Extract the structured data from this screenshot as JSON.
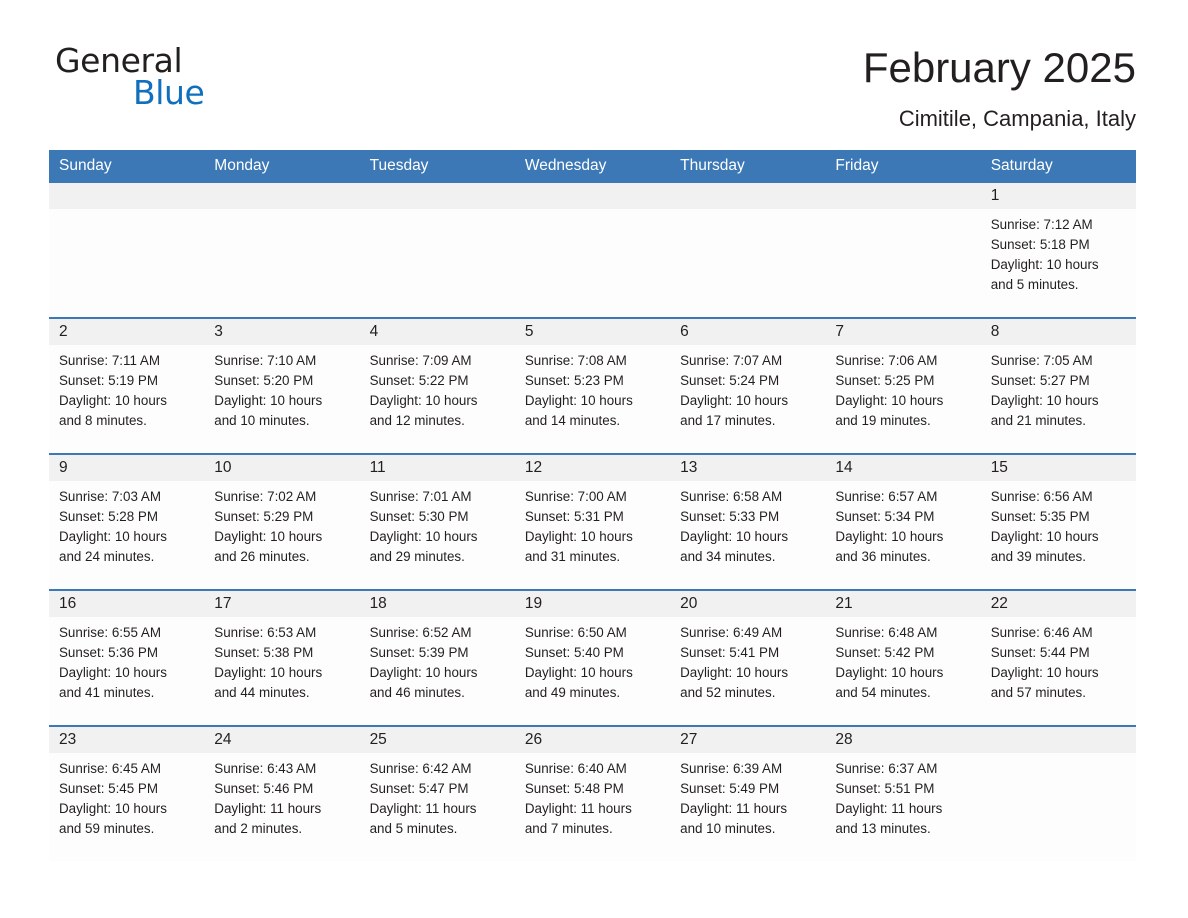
{
  "brand": {
    "name_part1": "General",
    "name_part2": "Blue",
    "logo_icon": "triangle-logo-icon",
    "accent_color": "#1070bd"
  },
  "header": {
    "title": "February 2025",
    "location": "Cimitile, Campania, Italy"
  },
  "theme": {
    "header_blue": "#3b78b5",
    "day_band_gray": "#f1f1f1",
    "text_color": "#231f20"
  },
  "weekdays": [
    "Sunday",
    "Monday",
    "Tuesday",
    "Wednesday",
    "Thursday",
    "Friday",
    "Saturday"
  ],
  "weeks": [
    [
      {
        "day": "",
        "sunrise": "",
        "sunset": "",
        "daylight_line1": "",
        "daylight_line2": "",
        "empty": true
      },
      {
        "day": "",
        "sunrise": "",
        "sunset": "",
        "daylight_line1": "",
        "daylight_line2": "",
        "empty": true
      },
      {
        "day": "",
        "sunrise": "",
        "sunset": "",
        "daylight_line1": "",
        "daylight_line2": "",
        "empty": true
      },
      {
        "day": "",
        "sunrise": "",
        "sunset": "",
        "daylight_line1": "",
        "daylight_line2": "",
        "empty": true
      },
      {
        "day": "",
        "sunrise": "",
        "sunset": "",
        "daylight_line1": "",
        "daylight_line2": "",
        "empty": true
      },
      {
        "day": "",
        "sunrise": "",
        "sunset": "",
        "daylight_line1": "",
        "daylight_line2": "",
        "empty": true
      },
      {
        "day": "1",
        "sunrise": "Sunrise: 7:12 AM",
        "sunset": "Sunset: 5:18 PM",
        "daylight_line1": "Daylight: 10 hours",
        "daylight_line2": "and 5 minutes.",
        "empty": false
      }
    ],
    [
      {
        "day": "2",
        "sunrise": "Sunrise: 7:11 AM",
        "sunset": "Sunset: 5:19 PM",
        "daylight_line1": "Daylight: 10 hours",
        "daylight_line2": "and 8 minutes.",
        "empty": false
      },
      {
        "day": "3",
        "sunrise": "Sunrise: 7:10 AM",
        "sunset": "Sunset: 5:20 PM",
        "daylight_line1": "Daylight: 10 hours",
        "daylight_line2": "and 10 minutes.",
        "empty": false
      },
      {
        "day": "4",
        "sunrise": "Sunrise: 7:09 AM",
        "sunset": "Sunset: 5:22 PM",
        "daylight_line1": "Daylight: 10 hours",
        "daylight_line2": "and 12 minutes.",
        "empty": false
      },
      {
        "day": "5",
        "sunrise": "Sunrise: 7:08 AM",
        "sunset": "Sunset: 5:23 PM",
        "daylight_line1": "Daylight: 10 hours",
        "daylight_line2": "and 14 minutes.",
        "empty": false
      },
      {
        "day": "6",
        "sunrise": "Sunrise: 7:07 AM",
        "sunset": "Sunset: 5:24 PM",
        "daylight_line1": "Daylight: 10 hours",
        "daylight_line2": "and 17 minutes.",
        "empty": false
      },
      {
        "day": "7",
        "sunrise": "Sunrise: 7:06 AM",
        "sunset": "Sunset: 5:25 PM",
        "daylight_line1": "Daylight: 10 hours",
        "daylight_line2": "and 19 minutes.",
        "empty": false
      },
      {
        "day": "8",
        "sunrise": "Sunrise: 7:05 AM",
        "sunset": "Sunset: 5:27 PM",
        "daylight_line1": "Daylight: 10 hours",
        "daylight_line2": "and 21 minutes.",
        "empty": false
      }
    ],
    [
      {
        "day": "9",
        "sunrise": "Sunrise: 7:03 AM",
        "sunset": "Sunset: 5:28 PM",
        "daylight_line1": "Daylight: 10 hours",
        "daylight_line2": "and 24 minutes.",
        "empty": false
      },
      {
        "day": "10",
        "sunrise": "Sunrise: 7:02 AM",
        "sunset": "Sunset: 5:29 PM",
        "daylight_line1": "Daylight: 10 hours",
        "daylight_line2": "and 26 minutes.",
        "empty": false
      },
      {
        "day": "11",
        "sunrise": "Sunrise: 7:01 AM",
        "sunset": "Sunset: 5:30 PM",
        "daylight_line1": "Daylight: 10 hours",
        "daylight_line2": "and 29 minutes.",
        "empty": false
      },
      {
        "day": "12",
        "sunrise": "Sunrise: 7:00 AM",
        "sunset": "Sunset: 5:31 PM",
        "daylight_line1": "Daylight: 10 hours",
        "daylight_line2": "and 31 minutes.",
        "empty": false
      },
      {
        "day": "13",
        "sunrise": "Sunrise: 6:58 AM",
        "sunset": "Sunset: 5:33 PM",
        "daylight_line1": "Daylight: 10 hours",
        "daylight_line2": "and 34 minutes.",
        "empty": false
      },
      {
        "day": "14",
        "sunrise": "Sunrise: 6:57 AM",
        "sunset": "Sunset: 5:34 PM",
        "daylight_line1": "Daylight: 10 hours",
        "daylight_line2": "and 36 minutes.",
        "empty": false
      },
      {
        "day": "15",
        "sunrise": "Sunrise: 6:56 AM",
        "sunset": "Sunset: 5:35 PM",
        "daylight_line1": "Daylight: 10 hours",
        "daylight_line2": "and 39 minutes.",
        "empty": false
      }
    ],
    [
      {
        "day": "16",
        "sunrise": "Sunrise: 6:55 AM",
        "sunset": "Sunset: 5:36 PM",
        "daylight_line1": "Daylight: 10 hours",
        "daylight_line2": "and 41 minutes.",
        "empty": false
      },
      {
        "day": "17",
        "sunrise": "Sunrise: 6:53 AM",
        "sunset": "Sunset: 5:38 PM",
        "daylight_line1": "Daylight: 10 hours",
        "daylight_line2": "and 44 minutes.",
        "empty": false
      },
      {
        "day": "18",
        "sunrise": "Sunrise: 6:52 AM",
        "sunset": "Sunset: 5:39 PM",
        "daylight_line1": "Daylight: 10 hours",
        "daylight_line2": "and 46 minutes.",
        "empty": false
      },
      {
        "day": "19",
        "sunrise": "Sunrise: 6:50 AM",
        "sunset": "Sunset: 5:40 PM",
        "daylight_line1": "Daylight: 10 hours",
        "daylight_line2": "and 49 minutes.",
        "empty": false
      },
      {
        "day": "20",
        "sunrise": "Sunrise: 6:49 AM",
        "sunset": "Sunset: 5:41 PM",
        "daylight_line1": "Daylight: 10 hours",
        "daylight_line2": "and 52 minutes.",
        "empty": false
      },
      {
        "day": "21",
        "sunrise": "Sunrise: 6:48 AM",
        "sunset": "Sunset: 5:42 PM",
        "daylight_line1": "Daylight: 10 hours",
        "daylight_line2": "and 54 minutes.",
        "empty": false
      },
      {
        "day": "22",
        "sunrise": "Sunrise: 6:46 AM",
        "sunset": "Sunset: 5:44 PM",
        "daylight_line1": "Daylight: 10 hours",
        "daylight_line2": "and 57 minutes.",
        "empty": false
      }
    ],
    [
      {
        "day": "23",
        "sunrise": "Sunrise: 6:45 AM",
        "sunset": "Sunset: 5:45 PM",
        "daylight_line1": "Daylight: 10 hours",
        "daylight_line2": "and 59 minutes.",
        "empty": false
      },
      {
        "day": "24",
        "sunrise": "Sunrise: 6:43 AM",
        "sunset": "Sunset: 5:46 PM",
        "daylight_line1": "Daylight: 11 hours",
        "daylight_line2": "and 2 minutes.",
        "empty": false
      },
      {
        "day": "25",
        "sunrise": "Sunrise: 6:42 AM",
        "sunset": "Sunset: 5:47 PM",
        "daylight_line1": "Daylight: 11 hours",
        "daylight_line2": "and 5 minutes.",
        "empty": false
      },
      {
        "day": "26",
        "sunrise": "Sunrise: 6:40 AM",
        "sunset": "Sunset: 5:48 PM",
        "daylight_line1": "Daylight: 11 hours",
        "daylight_line2": "and 7 minutes.",
        "empty": false
      },
      {
        "day": "27",
        "sunrise": "Sunrise: 6:39 AM",
        "sunset": "Sunset: 5:49 PM",
        "daylight_line1": "Daylight: 11 hours",
        "daylight_line2": "and 10 minutes.",
        "empty": false
      },
      {
        "day": "28",
        "sunrise": "Sunrise: 6:37 AM",
        "sunset": "Sunset: 5:51 PM",
        "daylight_line1": "Daylight: 11 hours",
        "daylight_line2": "and 13 minutes.",
        "empty": false
      },
      {
        "day": "",
        "sunrise": "",
        "sunset": "",
        "daylight_line1": "",
        "daylight_line2": "",
        "empty": true
      }
    ]
  ]
}
